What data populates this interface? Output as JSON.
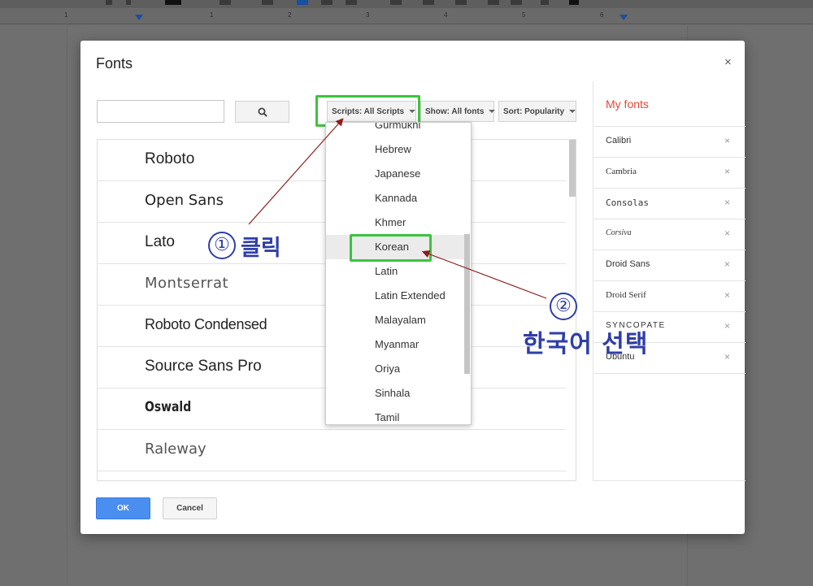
{
  "dialog": {
    "title": "Fonts",
    "close": "×",
    "search": {
      "placeholder": ""
    },
    "filters": {
      "scripts": "Scripts: All Scripts",
      "show": "Show: All fonts",
      "sort": "Sort: Popularity"
    },
    "fonts": [
      "Roboto",
      "Open Sans",
      "Lato",
      "Montserrat",
      "Roboto Condensed",
      "Source Sans Pro",
      "Oswald",
      "Raleway"
    ],
    "my_fonts": {
      "title": "My fonts",
      "items": [
        "Calibri",
        "Cambria",
        "Consolas",
        "Corsiva",
        "Droid Sans",
        "Droid Serif",
        "SYNCOPATE",
        "Ubuntu"
      ],
      "remove": "×"
    },
    "ok": "OK",
    "cancel": "Cancel"
  },
  "dropdown": {
    "items": [
      "Gurmukhi",
      "Hebrew",
      "Japanese",
      "Kannada",
      "Khmer",
      "Korean",
      "Latin",
      "Latin Extended",
      "Malayalam",
      "Myanmar",
      "Oriya",
      "Sinhala",
      "Tamil"
    ],
    "selected": "Korean"
  },
  "annotations": {
    "step1_num": "①",
    "step1_text": "클릭",
    "step2_num": "②",
    "step2_text": "한국어 선택"
  },
  "ruler": {
    "numbers": [
      "1",
      "1",
      "2",
      "3",
      "4",
      "5",
      "6"
    ]
  },
  "colors": {
    "accent_red": "#dd4b39",
    "ok_blue": "#4a8ef0",
    "highlight_green": "#3cc43c",
    "annotation_blue": "#2f3ea8"
  }
}
